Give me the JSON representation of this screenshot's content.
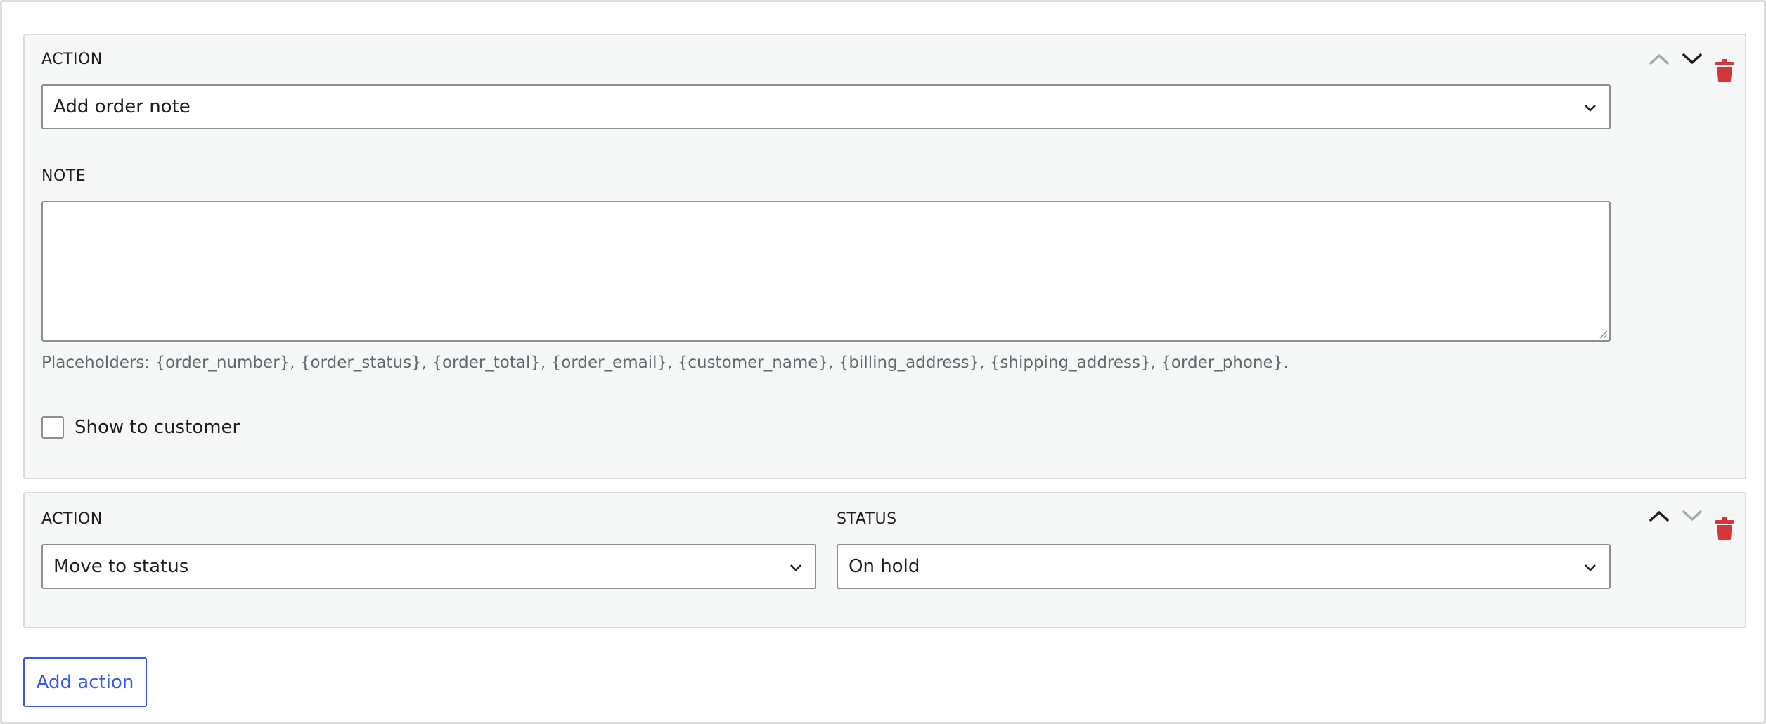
{
  "action_1": {
    "action_label": "ACTION",
    "action_value": "Add order note",
    "note_label": "NOTE",
    "note_value": "",
    "placeholders_help": "Placeholders: {order_number}, {order_status}, {order_total}, {order_email}, {customer_name}, {billing_address}, {shipping_address}, {order_phone}.",
    "show_to_customer_label": "Show to customer",
    "show_to_customer_checked": false,
    "move_up_enabled": false,
    "move_down_enabled": true
  },
  "action_2": {
    "action_label": "ACTION",
    "action_value": "Move to status",
    "status_label": "STATUS",
    "status_value": "On hold",
    "move_up_enabled": true,
    "move_down_enabled": false
  },
  "footer": {
    "add_action_label": "Add action"
  },
  "colors": {
    "accent": "#3858e9",
    "delete": "#d63638",
    "control_enabled": "#1e1e1e",
    "control_disabled": "#a7aaad",
    "panel_bg": "#f6f7f7",
    "border": "#8c8f94"
  },
  "icons": {
    "move_up": "chevron-up-icon",
    "move_down": "chevron-down-icon",
    "delete": "trash-icon",
    "select_caret": "chevron-down-icon"
  }
}
